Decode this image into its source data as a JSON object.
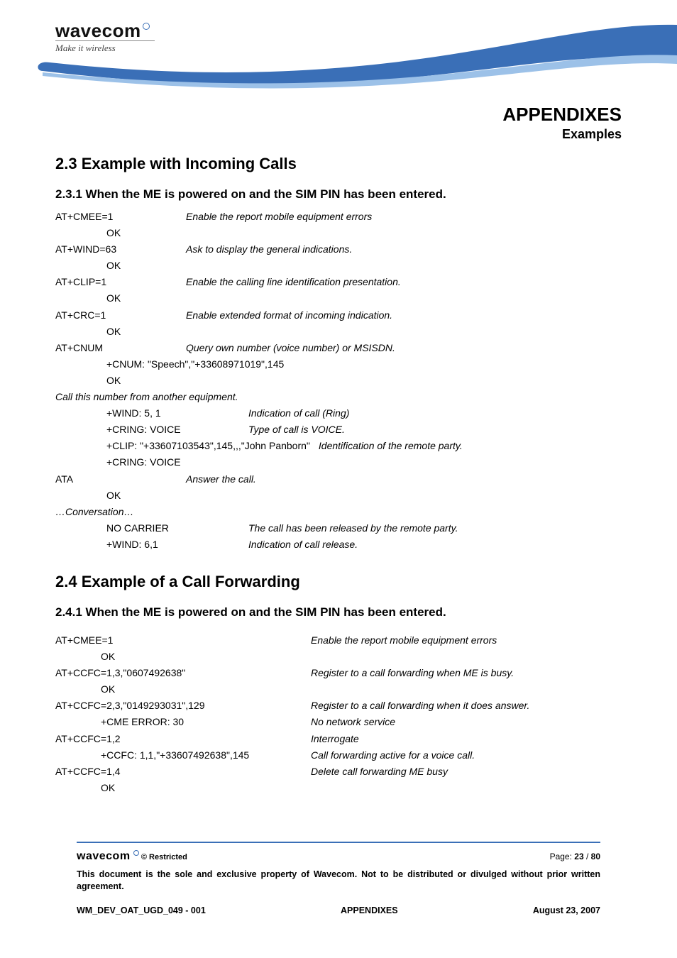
{
  "header": {
    "logo_text": "wavecom",
    "logo_tagline": "Make it wireless",
    "chapter": "APPENDIXES",
    "subchapter": "Examples"
  },
  "s23": {
    "title": "2.3 Example with Incoming Calls",
    "sub_title": "2.3.1 When the ME is powered on and the SIM PIN has been entered.",
    "rows": [
      {
        "a": "",
        "b": "AT+CMEE=1",
        "c_i": "Enable the report mobile equipment errors"
      },
      {
        "a": "",
        "b": "OK",
        "c": ""
      },
      {
        "a": "",
        "b": "AT+WIND=63",
        "c_i": "Ask to display the general indications."
      },
      {
        "a": "",
        "b": "OK",
        "c": ""
      },
      {
        "a": "",
        "b": "AT+CLIP=1",
        "c_i": "Enable the calling line identification presentation."
      },
      {
        "a": "",
        "b": "OK",
        "c": ""
      },
      {
        "a": "",
        "b": "AT+CRC=1",
        "c_i": "Enable extended format of incoming indication."
      },
      {
        "a": "",
        "b": "OK",
        "c": ""
      },
      {
        "a": "",
        "b": "AT+CNUM",
        "c_i": "Query own number (voice number) or MSISDN."
      },
      {
        "a": "",
        "b": "",
        "bc": "+CNUM: \"Speech\",\"+33608971019\",145"
      },
      {
        "a": "",
        "b": "OK",
        "c": ""
      }
    ],
    "note1": "Call this number from another equipment.",
    "rows2": [
      {
        "b": "+WIND: 5, 1",
        "c_i": "Indication of call (Ring)"
      },
      {
        "b": "+CRING: VOICE",
        "c_i": "Type of call is VOICE."
      },
      {
        "bc_plain": "+CLIP: \"+33607103543\",145,,,\"John Panborn\"",
        "bc_i": "Identification of the remote party."
      },
      {
        "b": "+CRING: VOICE",
        "c": ""
      }
    ],
    "ata_cmd": "ATA",
    "ata_desc": "Answer the call.",
    "rows3": [
      {
        "b": "OK",
        "c": ""
      }
    ],
    "note2": "…Conversation…",
    "rows4": [
      {
        "b": "NO CARRIER",
        "c_i": "The call has been released by the remote party."
      },
      {
        "b": "+WIND: 6,1",
        "c_i": "Indication of call release."
      }
    ]
  },
  "s24": {
    "title": "2.4 Example of a Call Forwarding",
    "sub_title": "2.4.1 When the ME is powered on and the SIM PIN has been entered.",
    "rows": [
      {
        "l": "AT+CMEE=1",
        "r_i": "Enable the report mobile equipment errors"
      },
      {
        "l_indent": "OK",
        "r": ""
      },
      {
        "l": "AT+CCFC=1,3,\"0607492638\"",
        "r_i": "Register to a call forwarding when ME is busy."
      },
      {
        "l_indent": "OK",
        "r": ""
      },
      {
        "l": "AT+CCFC=2,3,\"0149293031\",129",
        "r_i": "Register to a call forwarding when it does answer."
      },
      {
        "l_indent": "+CME ERROR: 30",
        "r_i": "No network service"
      },
      {
        "l": "AT+CCFC=1,2",
        "r_i": "Interrogate"
      },
      {
        "l_indent": "+CCFC: 1,1,\"+33607492638\",145",
        "r_i": "Call forwarding active for a voice call."
      },
      {
        "l": "AT+CCFC=1,4",
        "r_i": "Delete call forwarding ME busy"
      },
      {
        "l_indent": "OK",
        "r": ""
      }
    ]
  },
  "footer": {
    "logo_text": "wavecom",
    "restricted": "© Restricted",
    "page_label": "Page: ",
    "page_cur": "23",
    "page_sep": " / ",
    "page_tot": "80",
    "disclaimer": "This document is the sole and exclusive property of Wavecom. Not to be distributed or divulged without prior written agreement.",
    "doc_id": "WM_DEV_OAT_UGD_049 - 001",
    "center": "APPENDIXES",
    "date": "August 23, 2007"
  }
}
